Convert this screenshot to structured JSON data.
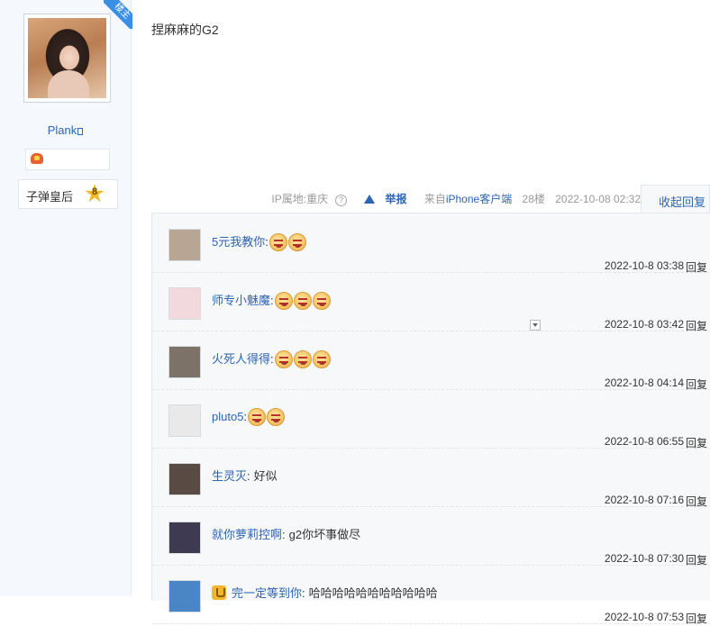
{
  "author": {
    "owner_badge": "楼主",
    "name": "Plank",
    "level_name": "子弹皇后",
    "level_num": "8"
  },
  "post": {
    "content": "捏麻麻的G2",
    "ip": "IP属地:重庆",
    "report": "举报",
    "client_prefix": "来自",
    "client": "iPhone客户端",
    "floor": "28楼",
    "time": "2022-10-08 02:32",
    "collapse": "收起回复"
  },
  "replies": [
    {
      "user": "5元我教你",
      "sep": ":",
      "text": "",
      "emoji": 2,
      "time": "2022-10-8 03:38",
      "reply": "回复",
      "avatar_color": "#b8a594"
    },
    {
      "user": "师专小魅魔",
      "sep": ":",
      "text": "",
      "emoji": 3,
      "time": "2022-10-8 03:42",
      "reply": "回复",
      "avatar_color": "#f1d9de"
    },
    {
      "user": "火死人得得",
      "sep": ":",
      "text": "",
      "emoji": 3,
      "time": "2022-10-8 04:14",
      "reply": "回复",
      "avatar_color": "#7c7268"
    },
    {
      "user": "pluto5",
      "sep": ":",
      "text": "",
      "emoji": 2,
      "time": "2022-10-8 06:55",
      "reply": "回复",
      "avatar_color": "#e9e9e9"
    },
    {
      "user": "生灵灭",
      "sep": ":",
      "text": "好似",
      "emoji": 0,
      "time": "2022-10-8 07:16",
      "reply": "回复",
      "avatar_color": "#5a4a44"
    },
    {
      "user": "就你萝莉控啊",
      "sep": ":",
      "text": "g2你坏事做尽",
      "emoji": 0,
      "time": "2022-10-8 07:30",
      "reply": "回复",
      "avatar_color": "#3e3a52"
    },
    {
      "user": "完一定等到你",
      "sep": ":",
      "text": "哈哈哈哈哈哈哈哈哈哈哈",
      "emoji": 0,
      "time": "2022-10-8 07:53",
      "reply": "回复",
      "avatar_color": "#4a86c5"
    }
  ]
}
